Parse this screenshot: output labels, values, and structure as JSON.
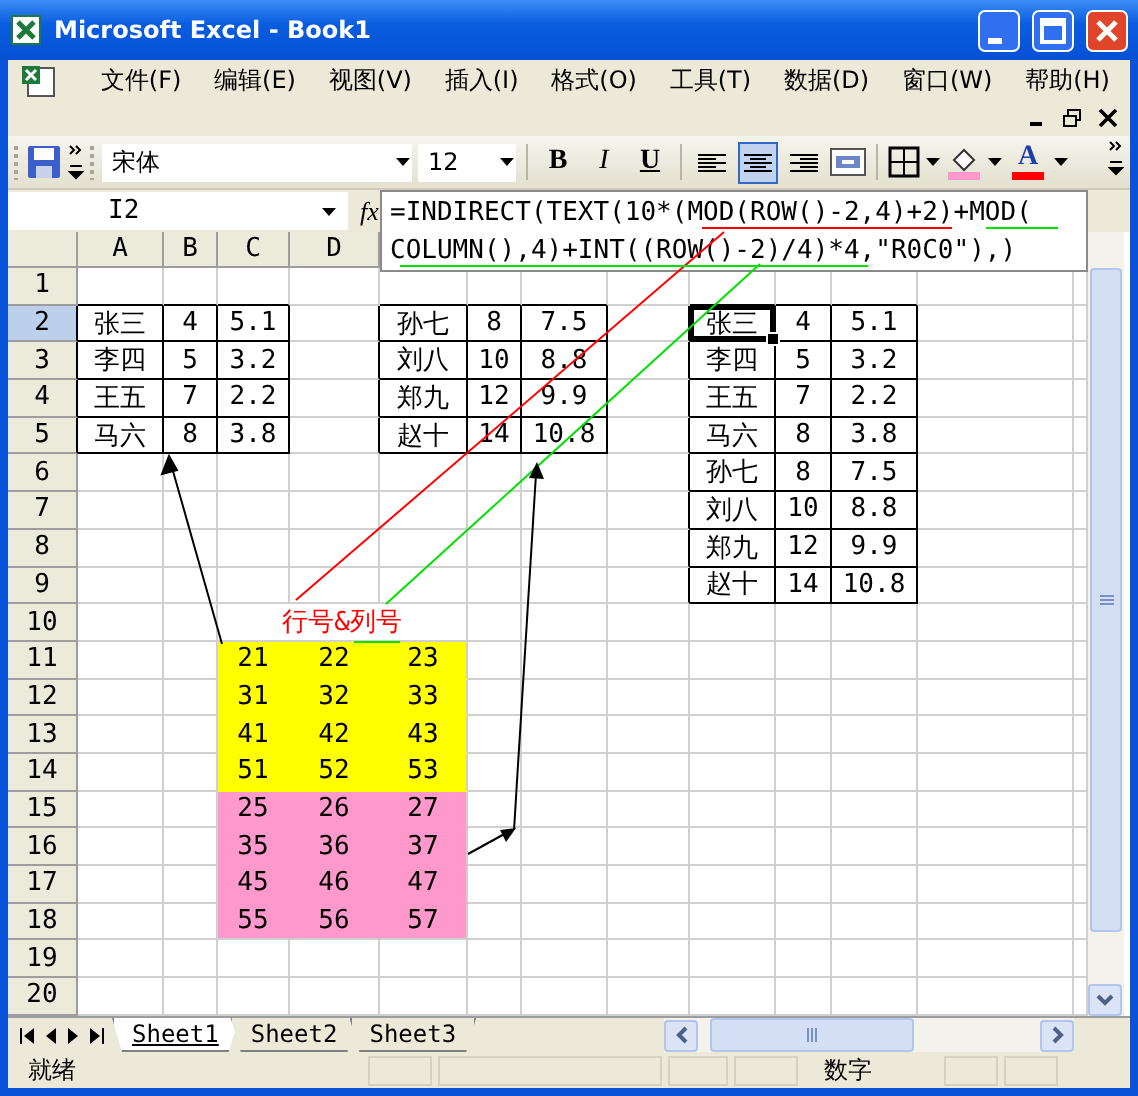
{
  "window": {
    "title": "Microsoft Excel - Book1"
  },
  "menu": [
    "文件(F)",
    "编辑(E)",
    "视图(V)",
    "插入(I)",
    "格式(O)",
    "工具(T)",
    "数据(D)",
    "窗口(W)",
    "帮助(H)"
  ],
  "toolbar": {
    "font": "宋体",
    "size": "12",
    "styles": [
      {
        "label": "B",
        "kind": "bold"
      },
      {
        "label": "I",
        "kind": "italic"
      },
      {
        "label": "U",
        "kind": "underline"
      }
    ],
    "align": [
      {
        "kind": "left",
        "selected": false
      },
      {
        "kind": "center",
        "selected": true
      },
      {
        "kind": "right",
        "selected": false
      }
    ],
    "font_color_label": "A"
  },
  "name_box": "I2",
  "formula_label": "fx",
  "formula_lines": [
    "=INDIRECT(TEXT(10*(MOD(ROW()-2,4)+2)+MOD(",
    "COLUMN(),4)+INT((ROW()-2)/4)*4,\"R0C0\"),)"
  ],
  "columns": [
    "A",
    "B",
    "C",
    "D"
  ],
  "rows": [
    {
      "label": "1",
      "selected": false
    },
    {
      "label": "2",
      "selected": true
    },
    {
      "label": "3",
      "selected": false
    },
    {
      "label": "4",
      "selected": false
    },
    {
      "label": "5",
      "selected": false
    },
    {
      "label": "6",
      "selected": false
    },
    {
      "label": "7",
      "selected": false
    },
    {
      "label": "8",
      "selected": false
    },
    {
      "label": "9",
      "selected": false
    },
    {
      "label": "10",
      "selected": false
    },
    {
      "label": "11",
      "selected": false
    },
    {
      "label": "12",
      "selected": false
    },
    {
      "label": "13",
      "selected": false
    },
    {
      "label": "14",
      "selected": false
    },
    {
      "label": "15",
      "selected": false
    },
    {
      "label": "16",
      "selected": false
    },
    {
      "label": "17",
      "selected": false
    },
    {
      "label": "18",
      "selected": false
    },
    {
      "label": "19",
      "selected": false
    },
    {
      "label": "20",
      "selected": false
    }
  ],
  "tables": [
    {
      "rows": [
        [
          "张三",
          "4",
          "5.1"
        ],
        [
          "李四",
          "5",
          "3.2"
        ],
        [
          "王五",
          "7",
          "2.2"
        ],
        [
          "马六",
          "8",
          "3.8"
        ]
      ]
    },
    {
      "rows": [
        [
          "孙七",
          "8",
          "7.5"
        ],
        [
          "刘八",
          "10",
          "8.8"
        ],
        [
          "郑九",
          "12",
          "9.9"
        ],
        [
          "赵十",
          "14",
          "10.8"
        ]
      ]
    },
    {
      "rows": [
        [
          {
            "text": "张三",
            "selected": true
          },
          "4",
          "5.1"
        ],
        [
          "李四",
          "5",
          "3.2"
        ],
        [
          "王五",
          "7",
          "2.2"
        ],
        [
          "马六",
          "8",
          "3.8"
        ],
        [
          "孙七",
          "8",
          "7.5"
        ],
        [
          "刘八",
          "10",
          "8.8"
        ],
        [
          "郑九",
          "12",
          "9.9"
        ],
        [
          "赵十",
          "14",
          "10.8"
        ]
      ]
    }
  ],
  "note": "行号&列号",
  "number_block": [
    {
      "color": "#ffff00",
      "values": [
        "21",
        "22",
        "23"
      ]
    },
    {
      "color": "#ffff00",
      "values": [
        "31",
        "32",
        "33"
      ]
    },
    {
      "color": "#ffff00",
      "values": [
        "41",
        "42",
        "43"
      ]
    },
    {
      "color": "#ffff00",
      "values": [
        "51",
        "52",
        "53"
      ]
    },
    {
      "color": "#ff99cc",
      "values": [
        "25",
        "26",
        "27"
      ]
    },
    {
      "color": "#ff99cc",
      "values": [
        "35",
        "36",
        "37"
      ]
    },
    {
      "color": "#ff99cc",
      "values": [
        "45",
        "46",
        "47"
      ]
    },
    {
      "color": "#ff99cc",
      "values": [
        "55",
        "56",
        "57"
      ]
    }
  ],
  "sheets": [
    {
      "label": "Sheet1",
      "selected": true
    },
    {
      "label": "Sheet2",
      "selected": false
    },
    {
      "label": "Sheet3",
      "selected": false
    }
  ],
  "status": {
    "mode": "就绪",
    "indicator": "数字"
  }
}
